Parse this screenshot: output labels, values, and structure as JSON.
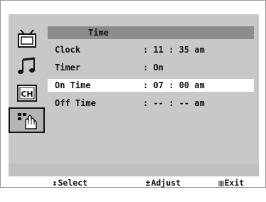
{
  "menu": {
    "title": "Time",
    "icons": [
      "tv-picture-icon",
      "sound-music-note-icon",
      "channel-ch-icon",
      "setup-hand-icon"
    ],
    "active_icon": 3,
    "rows": [
      {
        "label": "Clock",
        "value": ": 11 : 35 am",
        "selected": false
      },
      {
        "label": "Timer",
        "value": ": On",
        "selected": false
      },
      {
        "label": "On Time",
        "value": ": 07 : 00 am",
        "selected": true
      },
      {
        "label": "Off Time",
        "value": ": -- : -- am",
        "selected": false
      }
    ]
  },
  "hints": {
    "select": {
      "glyph": "↕",
      "label": "Select"
    },
    "adjust": {
      "glyph": "±",
      "label": "Adjust"
    },
    "exit": {
      "glyph": "▥",
      "label": "Exit"
    }
  }
}
